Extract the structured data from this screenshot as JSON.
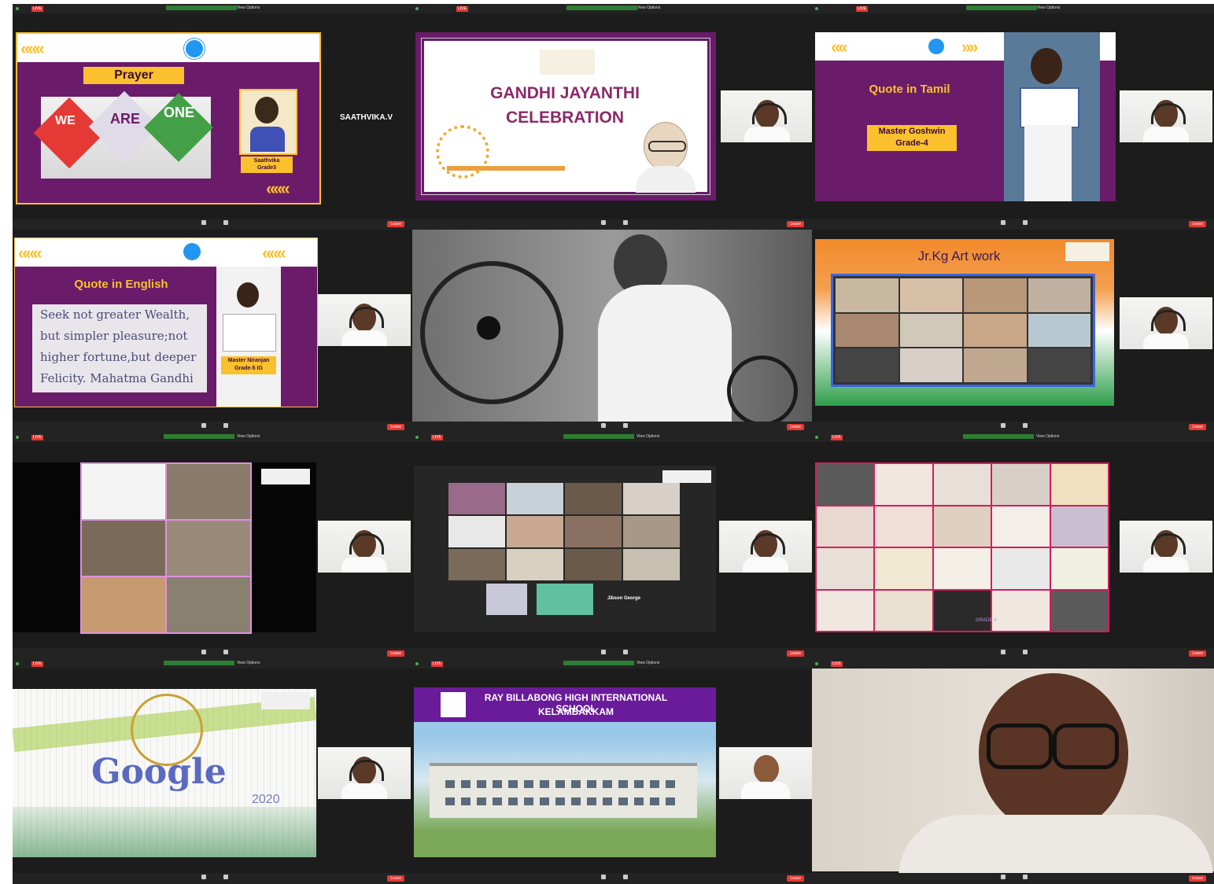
{
  "top_bar": {
    "live": "LIVE",
    "view_options": "View Options"
  },
  "bottom_bar": {
    "leave": "Leave"
  },
  "tiles": {
    "prayer": {
      "title": "Prayer",
      "kite_words": [
        "WE",
        "ARE",
        "ONE"
      ],
      "student_name": "Saathvika",
      "student_grade": "Grade3"
    },
    "participant_name": "SAATHVIKA.V",
    "gandhi": {
      "title_line1": "GANDHI JAYANTHI",
      "title_line2": "CELEBRATION"
    },
    "tamil": {
      "title": "Quote in Tamil",
      "student_name": "Master Goshwin",
      "student_grade": "Grade-4"
    },
    "english": {
      "title": "Quote in English",
      "quote": [
        "Seek not greater Wealth,",
        "but simpler pleasure;not",
        "higher fortune,but deeper",
        "Felicity. Mahatma Gandhi"
      ],
      "student_name": "Master Niranjan",
      "student_grade": "Grade-5 IG"
    },
    "artwork": {
      "title": "Jr.Kg Art work"
    },
    "gallery_label": "Jibson George",
    "grade_label": "GRADE 4",
    "doodle": {
      "word": "Google",
      "year": "2020"
    },
    "school": {
      "line1": "RAY BILLABONG HIGH INTERNATIONAL SCHOOL",
      "line2": "KELAMBAKKAM"
    }
  },
  "colors": {
    "purple": "#6a1b6a",
    "yellow": "#fbc02d",
    "gandhi_red": "#8b2a6a",
    "bar": "#232323",
    "leave": "#e53935"
  }
}
